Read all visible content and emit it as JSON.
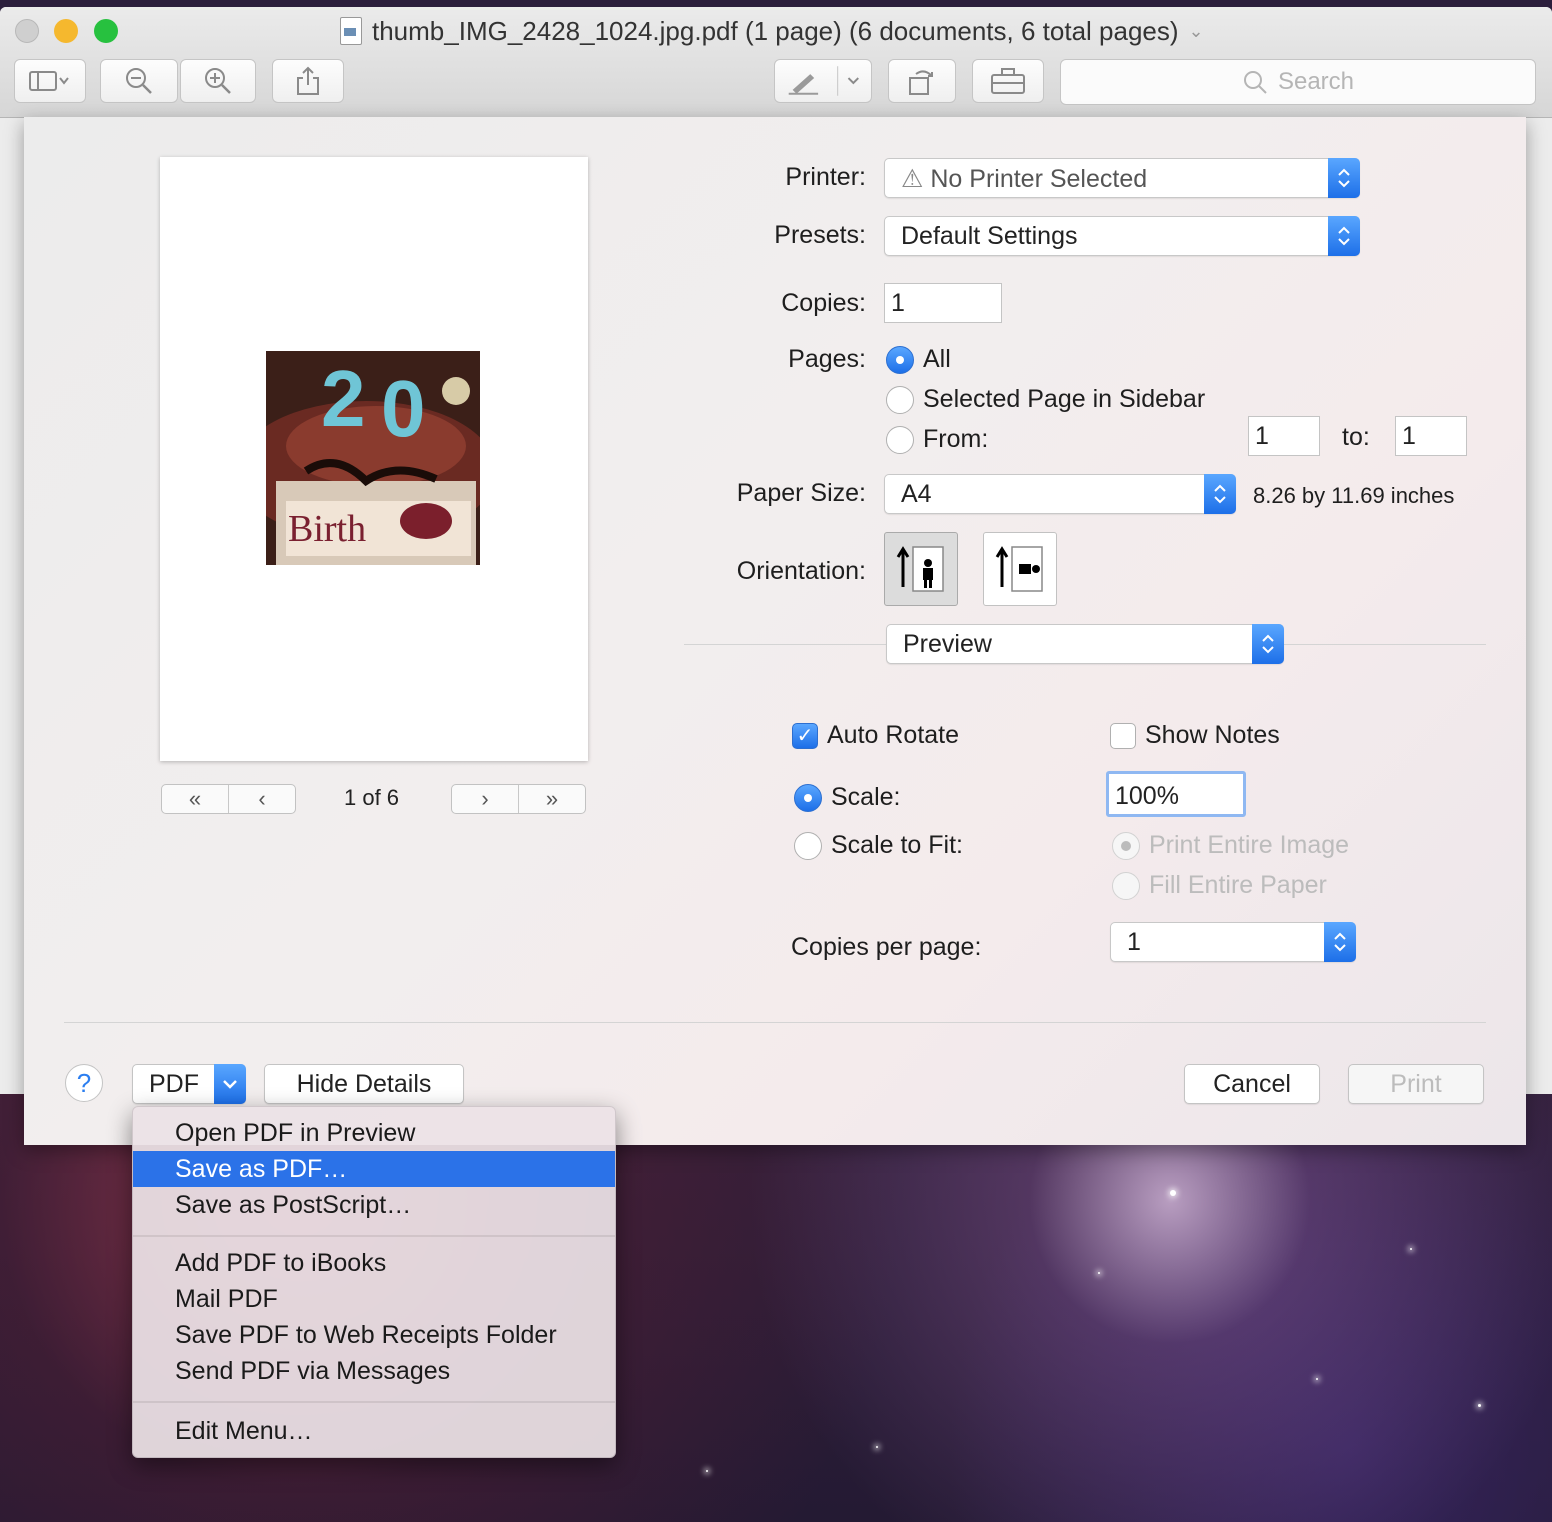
{
  "window": {
    "title": "thumb_IMG_2428_1024.jpg.pdf (1 page) (6 documents, 6 total pages)",
    "search_placeholder": "Search"
  },
  "preview": {
    "page_indicator": "1 of 6"
  },
  "print": {
    "printer_label": "Printer:",
    "printer_value": "No Printer Selected",
    "presets_label": "Presets:",
    "presets_value": "Default Settings",
    "copies_label": "Copies:",
    "copies_value": "1",
    "pages_label": "Pages:",
    "pages_all": "All",
    "pages_selected": "Selected Page in Sidebar",
    "pages_from": "From:",
    "from_value": "1",
    "to_label": "to:",
    "to_value": "1",
    "paper_size_label": "Paper Size:",
    "paper_size_value": "A4",
    "paper_size_dims": "8.26 by 11.69 inches",
    "orientation_label": "Orientation:",
    "section_value": "Preview",
    "auto_rotate": "Auto Rotate",
    "show_notes": "Show Notes",
    "scale_label": "Scale:",
    "scale_value": "100%",
    "scale_to_fit": "Scale to Fit:",
    "print_entire_image": "Print Entire Image",
    "fill_entire_paper": "Fill Entire Paper",
    "copies_per_page_label": "Copies per page:",
    "copies_per_page_value": "1"
  },
  "footer": {
    "help": "?",
    "pdf_label": "PDF",
    "hide_details": "Hide Details",
    "cancel": "Cancel",
    "print": "Print"
  },
  "pdf_menu": {
    "items": [
      "Open PDF in Preview",
      "Save as PDF…",
      "Save as PostScript…",
      "Add PDF to iBooks",
      "Mail PDF",
      "Save PDF to Web Receipts Folder",
      "Send PDF via Messages",
      "Edit Menu…"
    ],
    "highlighted": "Save as PDF…"
  },
  "colors": {
    "accent": "#2b72e8",
    "traffic_close": "#c9c9c9",
    "traffic_minimize": "#f5b82e",
    "traffic_zoom": "#27c13f"
  },
  "icons": [
    "sidebar-toggle-icon",
    "zoom-out-icon",
    "zoom-in-icon",
    "share-icon",
    "markup-pen-icon",
    "rotate-icon",
    "toolbox-icon",
    "search-icon",
    "warning-icon",
    "help-icon",
    "chevron-down-icon",
    "portrait-orientation-icon",
    "landscape-orientation-icon"
  ]
}
